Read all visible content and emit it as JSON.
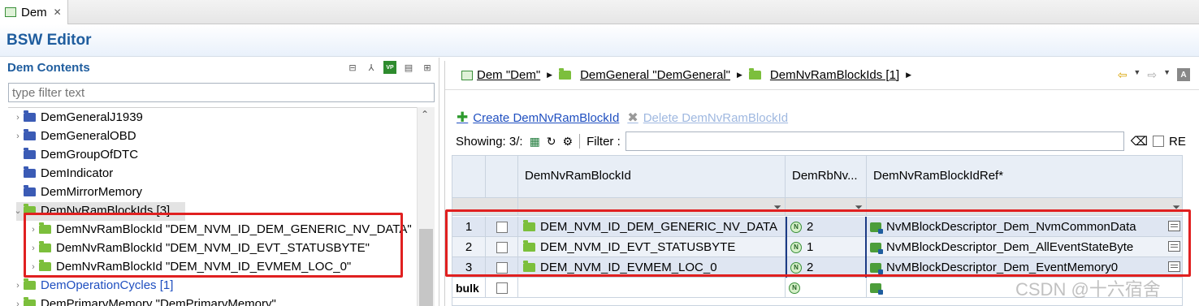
{
  "tab": {
    "label": "Dem"
  },
  "editor": {
    "title": "BSW Editor"
  },
  "left": {
    "title": "Dem Contents",
    "filter_placeholder": "type filter text",
    "tree": [
      {
        "label": "DemGeneralJ1939",
        "color": "blue",
        "twisty": "›",
        "link": false
      },
      {
        "label": "DemGeneralOBD",
        "color": "blue",
        "twisty": "›",
        "link": false
      },
      {
        "label": "DemGroupOfDTC",
        "color": "blue",
        "twisty": "",
        "link": false
      },
      {
        "label": "DemIndicator",
        "color": "blue",
        "twisty": "",
        "link": false
      },
      {
        "label": "DemMirrorMemory",
        "color": "blue",
        "twisty": "",
        "link": false
      },
      {
        "label": "DemNvRamBlockIds [3]",
        "color": "green",
        "twisty": "⌄",
        "link": false
      },
      {
        "label": "DemNvRamBlockId \"DEM_NVM_ID_DEM_GENERIC_NV_DATA\"",
        "color": "green",
        "twisty": "›",
        "link": false
      },
      {
        "label": "DemNvRamBlockId \"DEM_NVM_ID_EVT_STATUSBYTE\"",
        "color": "green",
        "twisty": "›",
        "link": false
      },
      {
        "label": "DemNvRamBlockId \"DEM_NVM_ID_EVMEM_LOC_0\"",
        "color": "green",
        "twisty": "›",
        "link": false
      },
      {
        "label": "DemOperationCycles [1]",
        "color": "green",
        "twisty": "›",
        "link": true
      },
      {
        "label": "DemPrimaryMemory \"DemPrimaryMemory\"",
        "color": "green",
        "twisty": "›",
        "link": false
      }
    ]
  },
  "breadcrumb": [
    {
      "label": "Dem \"Dem\""
    },
    {
      "label": "DemGeneral \"DemGeneral\""
    },
    {
      "label": "DemNvRamBlockIds [1]"
    }
  ],
  "actions": {
    "create": "Create DemNvRamBlockId",
    "delete": "Delete DemNvRamBlockId"
  },
  "toolbar": {
    "showing": "Showing: 3/:",
    "filter_label": "Filter :",
    "re_label": "RE"
  },
  "table": {
    "headers": [
      "DemNvRamBlockId",
      "DemRbNv...",
      "DemNvRamBlockIdRef*"
    ],
    "rows": [
      {
        "num": "1",
        "id": "DEM_NVM_ID_DEM_GENERIC_NV_DATA",
        "rb": "2",
        "ref": "NvMBlockDescriptor_Dem_NvmCommonData"
      },
      {
        "num": "2",
        "id": "DEM_NVM_ID_EVT_STATUSBYTE",
        "rb": "1",
        "ref": "NvMBlockDescriptor_Dem_AllEventStateByte"
      },
      {
        "num": "3",
        "id": "DEM_NVM_ID_EVMEM_LOC_0",
        "rb": "2",
        "ref": "NvMBlockDescriptor_Dem_EventMemory0"
      }
    ],
    "bulk_label": "bulk"
  },
  "watermark": "CSDN @十六宿舍",
  "colors": {
    "highlight_box": "#e02020",
    "title_blue": "#1f5d9e"
  }
}
